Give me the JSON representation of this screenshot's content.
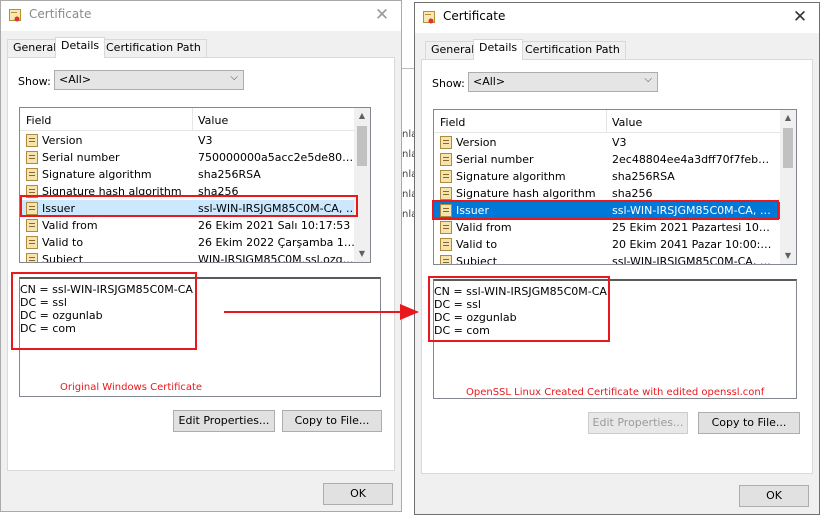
{
  "background_fragments": [
    "nla",
    "nla",
    "nla",
    "nla",
    "nla"
  ],
  "left": {
    "title": "Certificate",
    "close_glyph": "✕",
    "tabs": [
      "General",
      "Details",
      "Certification Path"
    ],
    "show_label": "Show:",
    "show_value": "<All>",
    "columns": {
      "field": "Field",
      "value": "Value"
    },
    "rows": [
      {
        "field": "Version",
        "value": "V3"
      },
      {
        "field": "Serial number",
        "value": "750000000a5acc2e5de8038a..."
      },
      {
        "field": "Signature algorithm",
        "value": "sha256RSA"
      },
      {
        "field": "Signature hash algorithm",
        "value": "sha256"
      },
      {
        "field": "Issuer",
        "value": "ssl-WIN-IRSJGM85C0M-CA, ss..."
      },
      {
        "field": "Valid from",
        "value": "26 Ekim 2021 Salı 10:17:53"
      },
      {
        "field": "Valid to",
        "value": "26 Ekim 2022 Çarşamba 10:17..."
      },
      {
        "field": "Subject",
        "value": "WIN-IRSJGM85C0M.ssl.ozgunl..."
      }
    ],
    "detail_lines": [
      "CN = ssl-WIN-IRSJGM85C0M-CA",
      "DC = ssl",
      "DC = ozgunlab",
      "DC = com"
    ],
    "caption": "Original Windows Certificate",
    "edit_button": "Edit Properties...",
    "copy_button": "Copy to File...",
    "ok_button": "OK"
  },
  "right": {
    "title": "Certificate",
    "close_glyph": "✕",
    "tabs": [
      "General",
      "Details",
      "Certification Path"
    ],
    "show_label": "Show:",
    "show_value": "<All>",
    "columns": {
      "field": "Field",
      "value": "Value"
    },
    "rows": [
      {
        "field": "Version",
        "value": "V3"
      },
      {
        "field": "Serial number",
        "value": "2ec48804ee4a3dff70f7feb657..."
      },
      {
        "field": "Signature algorithm",
        "value": "sha256RSA"
      },
      {
        "field": "Signature hash algorithm",
        "value": "sha256"
      },
      {
        "field": "Issuer",
        "value": "ssl-WIN-IRSJGM85C0M-CA, ss..."
      },
      {
        "field": "Valid from",
        "value": "25 Ekim 2021 Pazartesi 10:00:01"
      },
      {
        "field": "Valid to",
        "value": "20 Ekim 2041 Pazar 10:00:01"
      },
      {
        "field": "Subject",
        "value": "ssl-WIN-IRSJGM85C0M-CA, ss..."
      }
    ],
    "detail_lines": [
      "CN = ssl-WIN-IRSJGM85C0M-CA",
      "DC = ssl",
      "DC = ozgunlab",
      "DC = com"
    ],
    "caption": "OpenSSL Linux Created Certificate with edited openssl.conf",
    "edit_button": "Edit Properties...",
    "copy_button": "Copy to File...",
    "ok_button": "OK"
  },
  "colors": {
    "annotation": "#e8181d",
    "selection_active": "#0078d7",
    "selection_inactive": "#cce8ff"
  },
  "icons": [
    "certificate-icon",
    "close-icon",
    "chevron-down-icon",
    "field-icon",
    "arrow-icon"
  ]
}
